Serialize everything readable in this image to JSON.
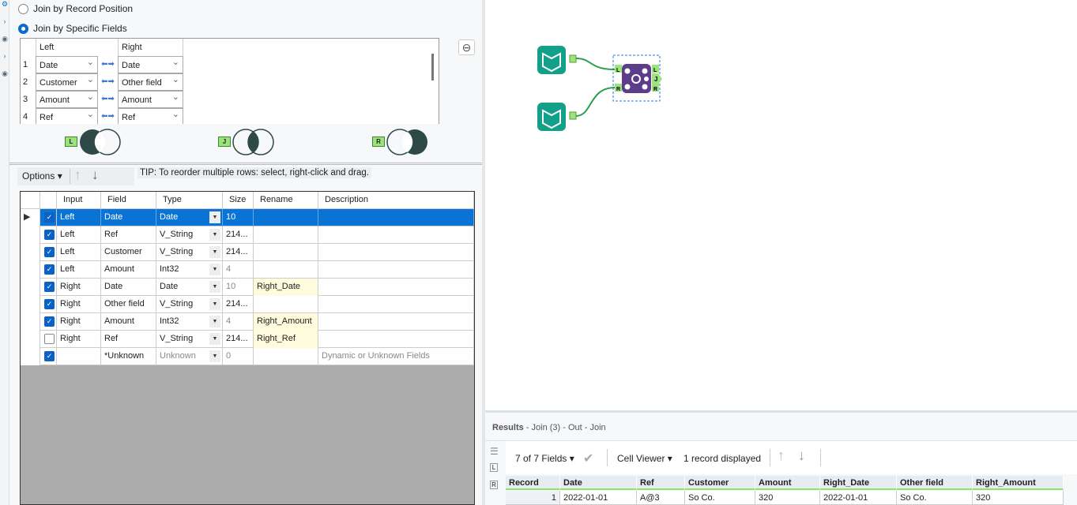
{
  "join_options": {
    "by_position": "Join by Record Position",
    "by_fields": "Join by Specific Fields",
    "selected": "by_fields"
  },
  "join_fields": {
    "headers": {
      "left": "Left",
      "right": "Right"
    },
    "rows": [
      {
        "n": "1",
        "left": "Date",
        "right": "Date"
      },
      {
        "n": "2",
        "left": "Customer",
        "right": "Other field"
      },
      {
        "n": "3",
        "left": "Amount",
        "right": "Amount"
      },
      {
        "n": "4",
        "left": "Ref",
        "right": "Ref"
      }
    ]
  },
  "venn_labels": [
    "L",
    "J",
    "R"
  ],
  "toolbar": {
    "options": "Options",
    "tip": "TIP: To reorder multiple rows: select, right-click and drag."
  },
  "fields_table": {
    "headers": [
      "Input",
      "Field",
      "Type",
      "Size",
      "Rename",
      "Description"
    ],
    "rows": [
      {
        "checked": true,
        "input": "Left",
        "field": "Date",
        "type": "Date",
        "size": "10",
        "rename": "",
        "desc": "",
        "selected": true
      },
      {
        "checked": true,
        "input": "Left",
        "field": "Ref",
        "type": "V_String",
        "size": "214...",
        "rename": "",
        "desc": ""
      },
      {
        "checked": true,
        "input": "Left",
        "field": "Customer",
        "type": "V_String",
        "size": "214...",
        "rename": "",
        "desc": ""
      },
      {
        "checked": true,
        "input": "Left",
        "field": "Amount",
        "type": "Int32",
        "size": "4",
        "rename": "",
        "desc": ""
      },
      {
        "checked": true,
        "input": "Right",
        "field": "Date",
        "type": "Date",
        "size": "10",
        "rename": "Right_Date",
        "desc": ""
      },
      {
        "checked": true,
        "input": "Right",
        "field": "Other field",
        "type": "V_String",
        "size": "214...",
        "rename": "",
        "desc": ""
      },
      {
        "checked": true,
        "input": "Right",
        "field": "Amount",
        "type": "Int32",
        "size": "4",
        "rename": "Right_Amount",
        "desc": ""
      },
      {
        "checked": false,
        "input": "Right",
        "field": "Ref",
        "type": "V_String",
        "size": "214...",
        "rename": "Right_Ref",
        "desc": ""
      },
      {
        "checked": true,
        "input": "",
        "field": "*Unknown",
        "type": "Unknown",
        "size": "0",
        "rename": "",
        "desc": "Dynamic or Unknown Fields"
      }
    ]
  },
  "canvas": {
    "join_ports_in": [
      "L",
      "R"
    ],
    "join_ports_out": [
      "L",
      "J",
      "R"
    ]
  },
  "results": {
    "title": "Results",
    "subtitle": " - Join (3) - Out - Join",
    "fields": "7 of 7 Fields",
    "cell_viewer": "Cell Viewer",
    "records": "1 record displayed",
    "headers": [
      "Record",
      "Date",
      "Ref",
      "Customer",
      "Amount",
      "Right_Date",
      "Other field",
      "Right_Amount"
    ],
    "rows": [
      [
        "1",
        "2022-01-01",
        "A@3",
        "So Co.",
        "320",
        "2022-01-01",
        "So Co.",
        "320"
      ]
    ]
  }
}
